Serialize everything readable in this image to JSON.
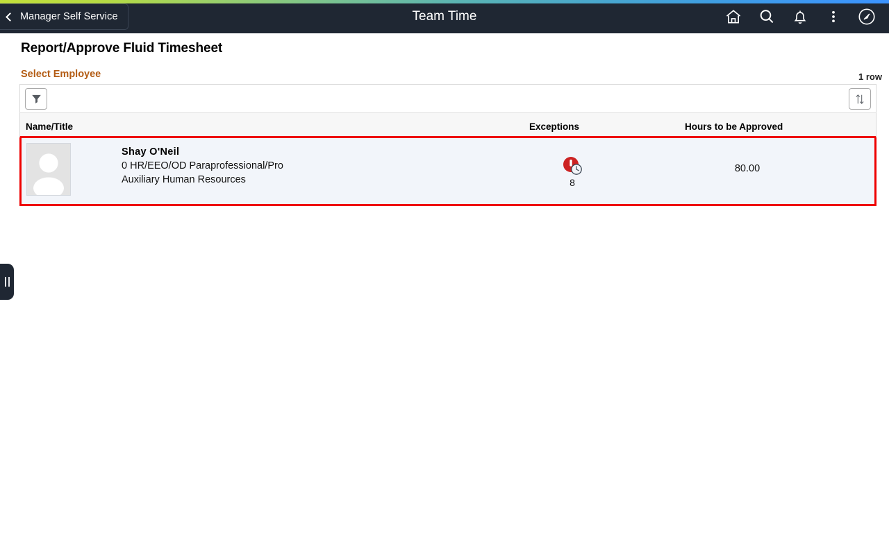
{
  "header": {
    "back_label": "Manager Self Service",
    "title": "Team Time",
    "icons": [
      {
        "name": "home-icon",
        "label": "Home"
      },
      {
        "name": "search-icon",
        "label": "Search"
      },
      {
        "name": "notifications-bell-icon",
        "label": "Notifications"
      },
      {
        "name": "kebab-menu-icon",
        "label": "Actions"
      },
      {
        "name": "navigator-compass-icon",
        "label": "NavBar"
      }
    ],
    "background_color": "#1f2733",
    "gradient_start": "#c3e03a",
    "gradient_end": "#3b93ff"
  },
  "page": {
    "title": "Report/Approve Fluid Timesheet",
    "section_label": "Select Employee",
    "section_label_color": "#b35c14",
    "row_count": "1 row"
  },
  "toolbar": {
    "filter_icon": "filter-funnel-icon",
    "sort_icon": "sort-updown-icon"
  },
  "grid": {
    "columns": [
      "Name/Title",
      "Exceptions",
      "Hours to be Approved"
    ],
    "header_underline_color": "#ee0000",
    "selection_border_color": "#ee0000",
    "row_background": "#f2f5fa",
    "rows": [
      {
        "avatar": "employee-photo-placeholder",
        "name": "Shay  O'Neil",
        "title": "0 HR/EEO/OD Paraprofessional/Pro",
        "department": "Auxiliary Human Resources",
        "exception_icon": "exception-alert-clock-icon",
        "exception_count": "8",
        "hours_to_be_approved": "80.00"
      }
    ]
  },
  "panel": {
    "handle_icon": "collapse-panel-handle-icon"
  }
}
